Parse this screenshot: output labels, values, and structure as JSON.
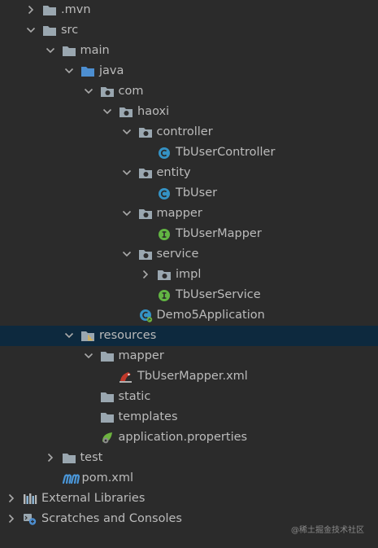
{
  "tree": {
    "items": [
      {
        "name": "tree-item-mvn",
        "label": ".mvn",
        "depth": 0,
        "expanded": false,
        "icon": "folder-icon"
      },
      {
        "name": "tree-item-src",
        "label": "src",
        "depth": 0,
        "expanded": true,
        "icon": "folder-icon"
      },
      {
        "name": "tree-item-main",
        "label": "main",
        "depth": 1,
        "expanded": true,
        "icon": "folder-icon"
      },
      {
        "name": "tree-item-java",
        "label": "java",
        "depth": 2,
        "expanded": true,
        "icon": "source-folder-icon"
      },
      {
        "name": "tree-item-com",
        "label": "com",
        "depth": 3,
        "expanded": true,
        "icon": "package-icon"
      },
      {
        "name": "tree-item-haoxi",
        "label": "haoxi",
        "depth": 4,
        "expanded": true,
        "icon": "package-icon"
      },
      {
        "name": "tree-item-controller",
        "label": "controller",
        "depth": 5,
        "expanded": true,
        "icon": "package-icon"
      },
      {
        "name": "tree-item-tbusercontroller",
        "label": "TbUserController",
        "depth": 6,
        "expanded": null,
        "icon": "class-icon"
      },
      {
        "name": "tree-item-entity",
        "label": "entity",
        "depth": 5,
        "expanded": true,
        "icon": "package-icon"
      },
      {
        "name": "tree-item-tbuser",
        "label": "TbUser",
        "depth": 6,
        "expanded": null,
        "icon": "class-icon"
      },
      {
        "name": "tree-item-mapper-package",
        "label": "mapper",
        "depth": 5,
        "expanded": true,
        "icon": "package-icon"
      },
      {
        "name": "tree-item-tbusermapper",
        "label": "TbUserMapper",
        "depth": 6,
        "expanded": null,
        "icon": "interface-icon"
      },
      {
        "name": "tree-item-service",
        "label": "service",
        "depth": 5,
        "expanded": true,
        "icon": "package-icon"
      },
      {
        "name": "tree-item-impl",
        "label": "impl",
        "depth": 6,
        "expanded": false,
        "icon": "package-icon"
      },
      {
        "name": "tree-item-tbuserservice",
        "label": "TbUserService",
        "depth": 6,
        "expanded": null,
        "icon": "interface-icon"
      },
      {
        "name": "tree-item-demo5application",
        "label": "Demo5Application",
        "depth": 5,
        "expanded": null,
        "icon": "spring-boot-class-icon"
      },
      {
        "name": "tree-item-resources",
        "label": "resources",
        "depth": 2,
        "expanded": true,
        "icon": "resources-folder-icon",
        "selected": true
      },
      {
        "name": "tree-item-mapper-folder",
        "label": "mapper",
        "depth": 3,
        "expanded": true,
        "icon": "folder-icon"
      },
      {
        "name": "tree-item-tbusermapper-xml",
        "label": "TbUserMapper.xml",
        "depth": 4,
        "expanded": null,
        "icon": "mybatis-xml-icon"
      },
      {
        "name": "tree-item-static",
        "label": "static",
        "depth": 3,
        "expanded": null,
        "icon": "folder-icon"
      },
      {
        "name": "tree-item-templates",
        "label": "templates",
        "depth": 3,
        "expanded": null,
        "icon": "folder-icon"
      },
      {
        "name": "tree-item-application-properties",
        "label": "application.properties",
        "depth": 3,
        "expanded": null,
        "icon": "spring-properties-icon"
      },
      {
        "name": "tree-item-test",
        "label": "test",
        "depth": 1,
        "expanded": false,
        "icon": "folder-icon"
      },
      {
        "name": "tree-item-pom",
        "label": "pom.xml",
        "depth": 1,
        "expanded": null,
        "icon": "maven-icon"
      },
      {
        "name": "tree-item-external-libraries",
        "label": "External Libraries",
        "depth": -1,
        "expanded": false,
        "icon": "libraries-icon"
      },
      {
        "name": "tree-item-scratches",
        "label": "Scratches and Consoles",
        "depth": -1,
        "expanded": false,
        "icon": "scratches-icon"
      }
    ]
  },
  "watermark": "@稀土掘金技术社区",
  "colors": {
    "background": "#2b2b2b",
    "text": "#bbbbbb",
    "selection": "#0d293e",
    "arrow": "#a9a9a9",
    "folder": "#9aa7b0",
    "source_folder": "#4d8fd1",
    "class": "#3592c4",
    "interface": "#62b543",
    "maven": "#4a96d8"
  }
}
